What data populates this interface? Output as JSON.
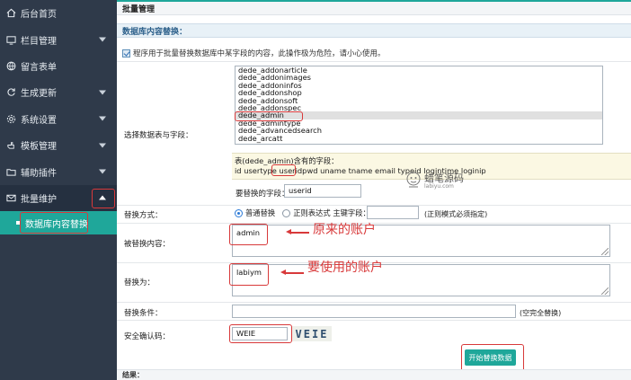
{
  "sidebar": {
    "items": [
      {
        "label": "后台首页",
        "icon": "home-icon"
      },
      {
        "label": "栏目管理",
        "icon": "monitor-icon"
      },
      {
        "label": "留言表单",
        "icon": "globe-icon"
      },
      {
        "label": "生成更新",
        "icon": "refresh-icon"
      },
      {
        "label": "系统设置",
        "icon": "gear-icon"
      },
      {
        "label": "模板管理",
        "icon": "hand-icon"
      },
      {
        "label": "辅助插件",
        "icon": "folder-icon"
      },
      {
        "label": "批量维护",
        "icon": "mail-icon"
      }
    ],
    "sub_item": "数据库内容替换"
  },
  "main": {
    "title": "批量管理",
    "section": "数据库内容替换：",
    "notice": "程序用于批量替换数据库中某字段的内容，此操作极为危险，请小心使用。",
    "select_label": "选择数据表与字段：",
    "tables": [
      "dede_addonarticle",
      "dede_addonimages",
      "dede_addoninfos",
      "dede_addonshop",
      "dede_addonsoft",
      "dede_addonspec",
      "dede_admin",
      "dede_admintype",
      "dede_advancedsearch",
      "dede_arcatt"
    ],
    "selected_table": "dede_admin",
    "fields_title": "表(dede_admin)含有的字段：",
    "fields": [
      "id",
      "usertype",
      "userid",
      "pwd",
      "uname",
      "tname",
      "email",
      "typeid",
      "logintime",
      "loginip"
    ],
    "replace_field_label": "要替换的字段：",
    "replace_field_value": "userid",
    "method_label": "替换方式：",
    "method_normal": "普通替换",
    "method_regex": "正则表达式 主键字段：",
    "regex_note": "(正则模式必须指定)",
    "replaced_label": "被替换内容：",
    "replaced_value": "admin",
    "replace_with_label": "替换为：",
    "replace_with_value": "labiym",
    "condition_label": "替换条件：",
    "condition_note": "(空完全替换)",
    "captcha_label": "安全确认码：",
    "captcha_value": "WEIE",
    "captcha_image_text": "VEIE",
    "submit_label": "开始替换数据",
    "result_label": "结果："
  },
  "annotations": {
    "original_account": "原来的账户",
    "new_account": "要使用的账户"
  },
  "watermark": {
    "name": "蜡笔源码",
    "url": "labiyu.com"
  },
  "colors": {
    "sidebar_bg": "#2f3a4a",
    "accent": "#1fa79a",
    "annotation_red": "#d8393a"
  }
}
